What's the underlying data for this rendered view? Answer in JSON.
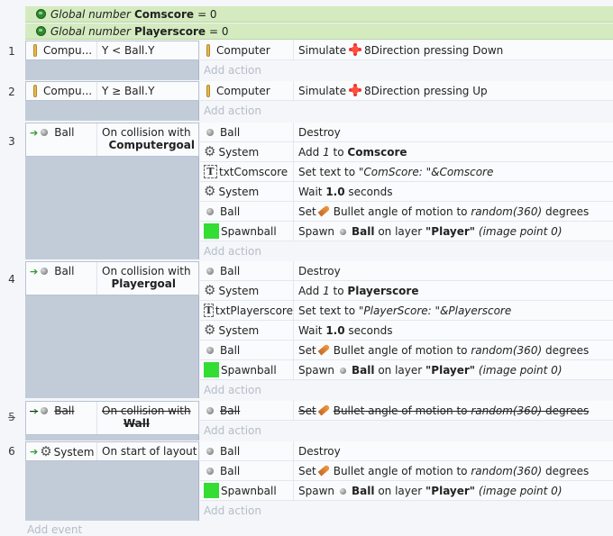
{
  "globals": [
    {
      "kind": "Global number",
      "name": "Comscore",
      "value": "= 0"
    },
    {
      "kind": "Global number",
      "name": "Playerscore",
      "value": "= 0"
    }
  ],
  "add_action_label": "Add action",
  "add_event_label": "Add event",
  "events": [
    {
      "number": "1",
      "condition": {
        "object": "Compu...",
        "text": "Y < Ball.Y"
      },
      "actions": [
        {
          "object": "Computer",
          "text": "Simulate",
          "behavior": "8Direction pressing Down"
        }
      ]
    },
    {
      "number": "2",
      "condition": {
        "object": "Compu...",
        "text": "Y ≥ Ball.Y"
      },
      "actions": [
        {
          "object": "Computer",
          "text": "Simulate",
          "behavior": "8Direction pressing Up"
        }
      ]
    },
    {
      "number": "3",
      "condition": {
        "object": "Ball",
        "line1": "On collision with",
        "line2": "Computergoal"
      },
      "actions": [
        {
          "object": "Ball",
          "text": "Destroy"
        },
        {
          "object": "System",
          "pre": "Add",
          "num": "1",
          "mid": "to",
          "var": "Comscore"
        },
        {
          "object": "txtComscore",
          "pre": "Set text to",
          "expr": "\"ComScore: \"&Comscore"
        },
        {
          "object": "System",
          "pre": "Wait",
          "num": "1.0",
          "post": "seconds"
        },
        {
          "object": "Ball",
          "pre": "Set",
          "mid": "Bullet angle of motion to",
          "expr": "random(360)",
          "post": "degrees"
        },
        {
          "object": "Spawnball",
          "pre": "Spawn",
          "obj": "Ball",
          "mid": "on layer",
          "layer": "\"Player\"",
          "tail": "(image point 0)"
        }
      ]
    },
    {
      "number": "4",
      "condition": {
        "object": "Ball",
        "line1": "On collision with",
        "line2": "Playergoal"
      },
      "actions": [
        {
          "object": "Ball",
          "text": "Destroy"
        },
        {
          "object": "System",
          "pre": "Add",
          "num": "1",
          "mid": "to",
          "var": "Playerscore"
        },
        {
          "object": "txtPlayerscore",
          "pre": "Set text to",
          "expr": "\"PlayerScore: \"&Playerscore"
        },
        {
          "object": "System",
          "pre": "Wait",
          "num": "1.0",
          "post": "seconds"
        },
        {
          "object": "Ball",
          "pre": "Set",
          "mid": "Bullet angle of motion to",
          "expr": "random(360)",
          "post": "degrees"
        },
        {
          "object": "Spawnball",
          "pre": "Spawn",
          "obj": "Ball",
          "mid": "on layer",
          "layer": "\"Player\"",
          "tail": "(image point 0)"
        }
      ]
    },
    {
      "number": "5",
      "disabled": true,
      "condition": {
        "object": "Ball",
        "line1": "On collision with",
        "line2": "Wall"
      },
      "actions": [
        {
          "object": "Ball",
          "pre": "Set",
          "mid": "Bullet angle of motion to",
          "expr": "random(360)",
          "post": "degrees"
        }
      ]
    },
    {
      "number": "6",
      "condition": {
        "object": "System",
        "text": "On start of layout"
      },
      "actions": [
        {
          "object": "Ball",
          "text": "Destroy"
        },
        {
          "object": "Ball",
          "pre": "Set",
          "mid": "Bullet angle of motion to",
          "expr": "random(360)",
          "post": "degrees"
        },
        {
          "object": "Spawnball",
          "pre": "Spawn",
          "obj": "Ball",
          "mid": "on layer",
          "layer": "\"Player\"",
          "tail": "(image point 0)"
        }
      ]
    }
  ]
}
